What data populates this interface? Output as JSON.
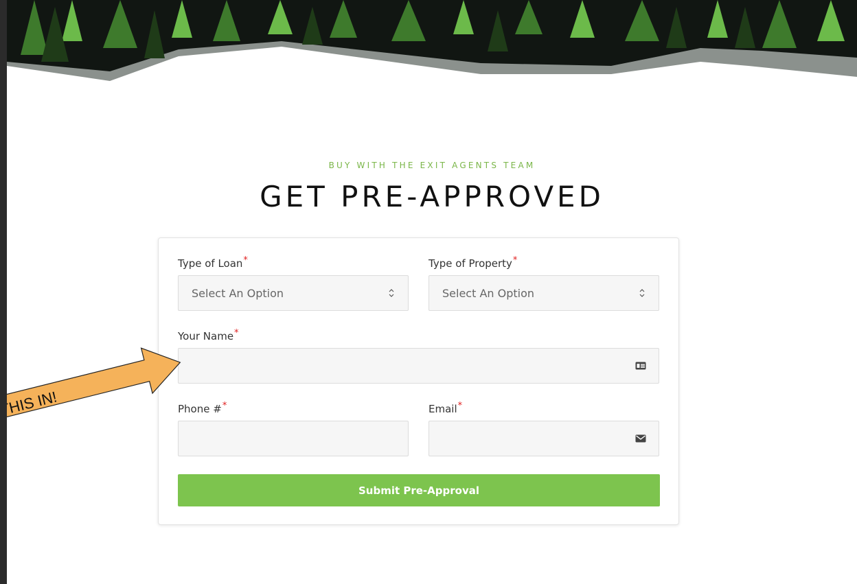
{
  "section": {
    "eyebrow": "BUY WITH THE EXIT AGENTS TEAM",
    "title": "GET PRE-APPROVED"
  },
  "form": {
    "loan_type": {
      "label": "Type of Loan",
      "selected": "Select An Option"
    },
    "property_type": {
      "label": "Type of Property",
      "selected": "Select An Option"
    },
    "name": {
      "label": "Your Name",
      "value": ""
    },
    "phone": {
      "label": "Phone #",
      "value": ""
    },
    "email": {
      "label": "Email",
      "value": ""
    },
    "required_marker": "*",
    "submit_label": "Submit Pre-Approval"
  },
  "annotation": {
    "text": "THIS IN!"
  },
  "colors": {
    "accent": "#7dc44e",
    "required": "#e02020",
    "arrow_fill": "#f5b25a"
  },
  "icons": [
    "select-arrows-icon",
    "id-card-icon",
    "envelope-icon"
  ]
}
